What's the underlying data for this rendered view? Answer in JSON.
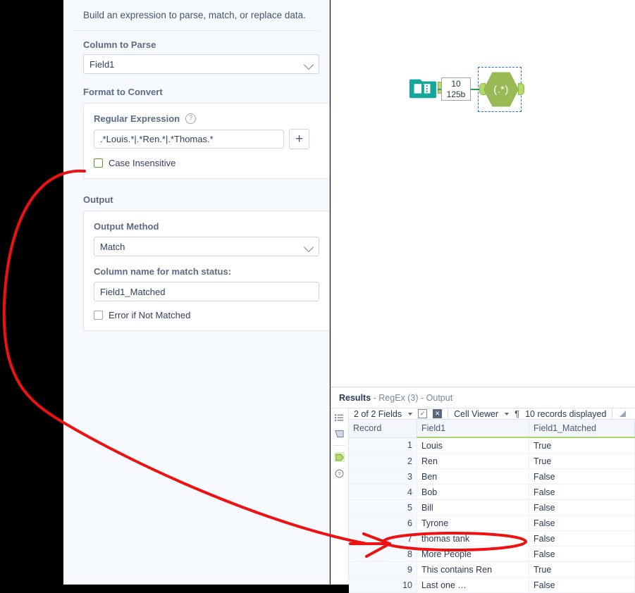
{
  "config_panel": {
    "intro_text": "Build an expression to parse, match, or replace data.",
    "column_to_parse": {
      "label": "Column to Parse",
      "value": "Field1",
      "chevron_icon": "chevron-down-icon"
    },
    "format_to_convert": {
      "label": "Format to Convert",
      "regex_label": "Regular Expression",
      "help_icon": "question-mark-icon",
      "regex_value": ".*Louis.*|.*Ren.*|.*Thomas.*",
      "add_button_label": "+",
      "case_insensitive_label": "Case Insensitive",
      "case_insensitive_checked": false,
      "highlight_color": "#ffe000",
      "checkbox_border_color": "#5aa02c"
    },
    "output": {
      "label": "Output",
      "method_label": "Output Method",
      "method_value": "Match",
      "column_name_label": "Column name for match status:",
      "column_name_value": "Field1_Matched",
      "error_if_not_matched_label": "Error if Not Matched",
      "error_if_not_matched_checked": false
    }
  },
  "canvas": {
    "input_node": {
      "name": "text-input-node",
      "icon": "book-icon",
      "color": "#17a79a"
    },
    "connection_label": {
      "records": "10",
      "size": "125b"
    },
    "regex_node": {
      "name": "regex-node",
      "glyph": "(.*)",
      "color": "#97b956",
      "selected": true,
      "selection_color": "#1f6fd0"
    }
  },
  "results": {
    "title_bold": "Results",
    "title_rest": "- RegEx (3) - Output",
    "rail_icons": [
      "list-icon",
      "panel-icon",
      "output-anchor-icon",
      "help-icon"
    ],
    "toolbar": {
      "fields_label": "2 of 2 Fields",
      "select-all_icon": "checkbox-check-icon",
      "deselect_icon": "checkbox-x-icon",
      "cell_viewer_label": "Cell Viewer",
      "pilcrow_icon": "pilcrow-icon",
      "records_label": "10 records displayed",
      "corner_icon": "resize-corner-icon"
    },
    "table": {
      "columns": [
        "Record",
        "Field1",
        "Field1_Matched"
      ],
      "rows": [
        [
          "1",
          "Louis",
          "True"
        ],
        [
          "2",
          "Ren",
          "True"
        ],
        [
          "3",
          "Ben",
          "False"
        ],
        [
          "4",
          "Bob",
          "False"
        ],
        [
          "5",
          "Bill",
          "False"
        ],
        [
          "6",
          "Tyrone",
          "False"
        ],
        [
          "7",
          "thomas tank",
          "False"
        ],
        [
          "8",
          "More People",
          "False"
        ],
        [
          "9",
          "This contains Ren",
          "True"
        ],
        [
          "10",
          "Last one …",
          "False"
        ]
      ],
      "highlight_row_index": 6
    }
  },
  "annotation": {
    "color": "#ee1111",
    "shapes": [
      "curved-arrow-from-case-insensitive-to-row-7",
      "ellipse-around-row-7"
    ]
  }
}
